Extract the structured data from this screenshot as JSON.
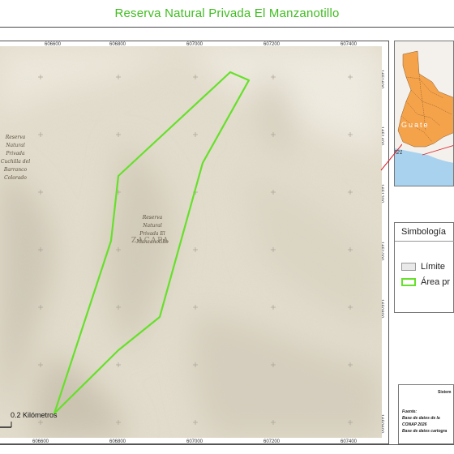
{
  "title": "Reserva Natural Privada El Manzanotillo",
  "map": {
    "x_ticks": [
      "606600",
      "606800",
      "607000",
      "607200",
      "607400"
    ],
    "y_ticks": [
      "1651600",
      "1651400",
      "1651200",
      "1651000",
      "1650800",
      "1650600"
    ],
    "labels": {
      "left_reserve": [
        "Reserva",
        "Natural",
        "Privada",
        "Cuchilla del",
        "Barranco",
        "Colorado"
      ],
      "center_reserve": [
        "Reserva",
        "Natural",
        "Privada El",
        "Manzanotillo"
      ],
      "department": "ZACAPA"
    },
    "scale_label": "0.2 Kilómetros",
    "colors": {
      "boundary": "#66e02a",
      "terrain": "#e3ddcd",
      "grid_cross": "#a8a294"
    }
  },
  "inset": {
    "country_label": "Guate",
    "number_label": "721",
    "colors": {
      "water": "#a9d2ef",
      "land": "#f4f1ec",
      "highlight": "#f5a34b",
      "pointer": "#d9222a"
    }
  },
  "legend": {
    "title": "Simbología",
    "items": [
      {
        "label": "Límite",
        "swatch": "gray"
      },
      {
        "label": "Área pr",
        "swatch": "green-outline"
      }
    ]
  },
  "credits": {
    "system": "Sistem",
    "source_label": "Fuente:",
    "lines": [
      "Base de datos de la",
      "CONAP 2026",
      "Base de datos cartogra"
    ]
  }
}
